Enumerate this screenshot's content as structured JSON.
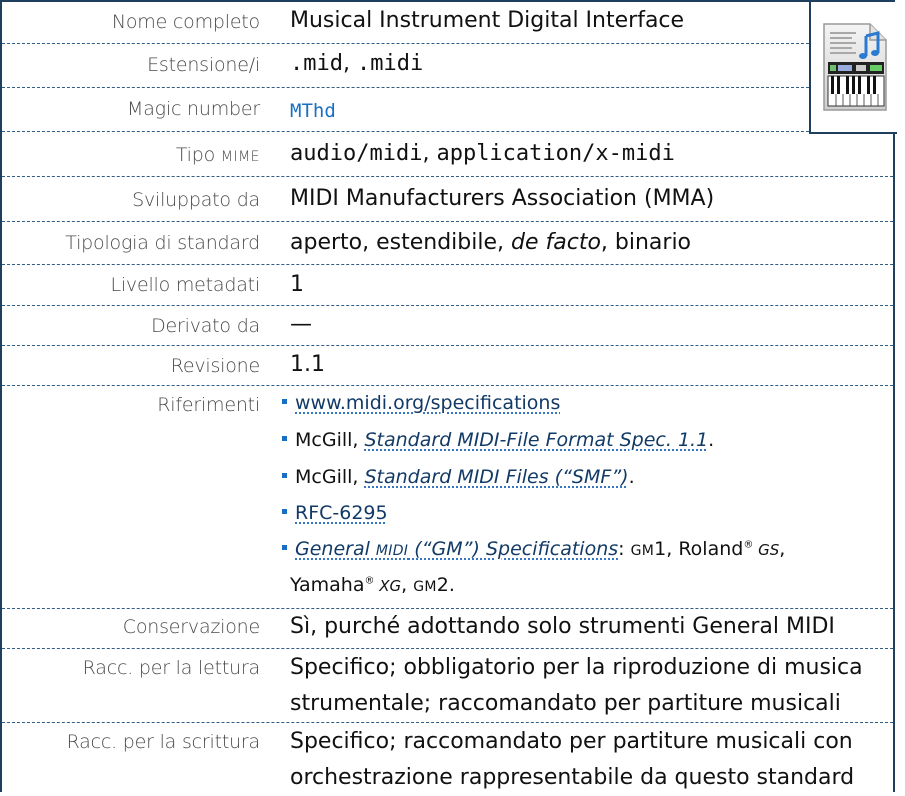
{
  "rows": {
    "nome_completo": {
      "label": "Nome completo",
      "value": "Musical Instrument Digital Interface"
    },
    "estensione": {
      "label": "Estensione/i",
      "value_1": ".mid",
      "sep": ", ",
      "value_2": ".midi"
    },
    "magic": {
      "label": "Magic number",
      "value": "MThd"
    },
    "mime": {
      "label_1": "Tipo ",
      "label_2": "MIME",
      "value_1": "audio/midi",
      "sep": ", ",
      "value_2": "application/x-midi"
    },
    "sviluppato": {
      "label": "Sviluppato da",
      "value": "MIDI Manufacturers Association (MMA)"
    },
    "tipologia": {
      "label": "Tipologia di standard",
      "value_1": "aperto, estendibile, ",
      "value_2": "de facto",
      "value_3": ", binario"
    },
    "livello": {
      "label": "Livello metadati",
      "value": "1"
    },
    "derivato": {
      "label": "Derivato da",
      "value": "—"
    },
    "revisione": {
      "label": "Revisione",
      "value": "1.1"
    },
    "riferimenti": {
      "label": "Riferimenti",
      "ref1_link": "www.midi.org/specifications",
      "ref2_pre": "McGill, ",
      "ref2_link": "Standard MIDI-File Format Spec. 1.1",
      "ref2_post": ".",
      "ref3_pre": "McGill, ",
      "ref3_link": "Standard MIDI Files (“SMF”)",
      "ref3_post": ".",
      "ref4_link": "RFC-6295",
      "ref5_link_1": "General ",
      "ref5_link_2": "MIDI",
      "ref5_link_3": " (“GM”) Specifications",
      "ref5_post_1": ": ",
      "ref5_gm1_a": "GM",
      "ref5_gm1_b": "1",
      "ref5_post_2": ", Roland",
      "ref5_reg_1": "®",
      "ref5_gs": " GS",
      "ref5_post_3": ",",
      "ref5_line2_1": "Yamaha",
      "ref5_reg_2": "®",
      "ref5_xg": " XG",
      "ref5_line2_2": ", ",
      "ref5_gm2_a": "GM",
      "ref5_gm2_b": "2",
      "ref5_line2_3": "."
    },
    "conservazione": {
      "label": "Conservazione",
      "value": "Sì, purché adottando solo strumenti General MIDI"
    },
    "lettura": {
      "label": "Racc. per la lettura",
      "line_1": "Specifico; obbligatorio per la riproduzione di musica",
      "line_2": "strumentale; raccomandato per partiture musicali"
    },
    "scrittura": {
      "label": "Racc. per la scrittura",
      "line_1": "Specifico; raccomandato per partiture musicali con",
      "line_2": "orchestrazione rappresentabile da questo standard"
    }
  },
  "icon": {
    "name": "midi-file-icon"
  },
  "colors": {
    "border": "#1f3f5f",
    "divider": "#2e5d85",
    "link": "#123a66",
    "accent": "#1a6fc4",
    "label": "#4a4a4a"
  }
}
